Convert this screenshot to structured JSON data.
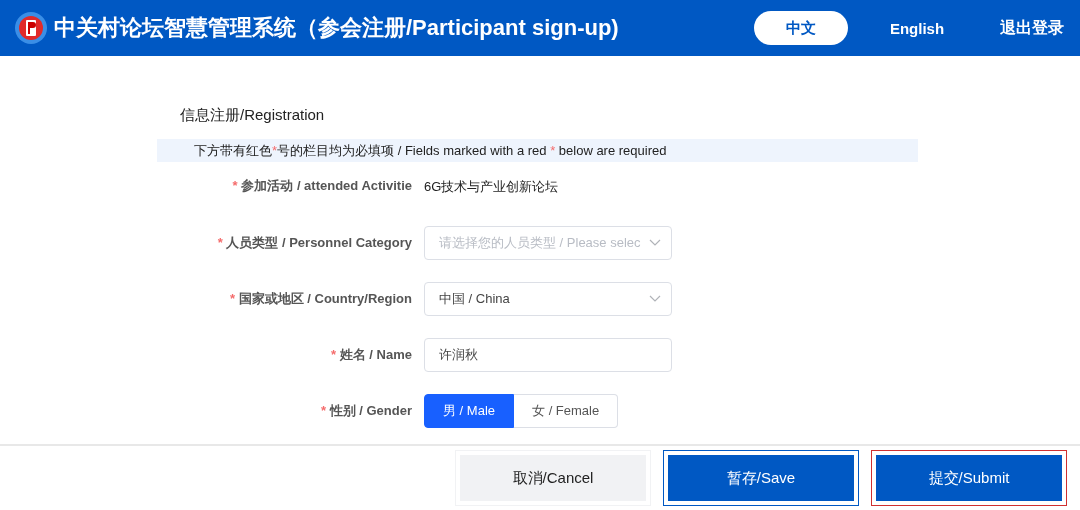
{
  "header": {
    "title": "中关村论坛智慧管理系统（参会注册/Participant sign-up)",
    "languages": [
      {
        "label": "中文",
        "selected": true
      },
      {
        "label": "English",
        "selected": false
      }
    ],
    "logout": "退出登录"
  },
  "section_title": "信息注册/Registration",
  "notice": [
    {
      "kind": "text",
      "text": "下方带有红色"
    },
    {
      "kind": "mark",
      "text": "*"
    },
    {
      "kind": "text",
      "text": "号的栏目均为必填项 / Fields marked with a red "
    },
    {
      "kind": "mark",
      "text": "*"
    },
    {
      "kind": "text",
      "text": " below are required"
    }
  ],
  "fields": [
    {
      "kind": "text",
      "required_mark": "*",
      "label": "参加活动 / attended Activitie",
      "value": "6G技术与产业创新论坛"
    },
    {
      "kind": "select",
      "required_mark": "*",
      "label": "人员类型 / Personnel Category",
      "placeholder": "请选择您的人员类型 / Please selec"
    },
    {
      "kind": "select",
      "required_mark": "*",
      "label": "国家或地区 / Country/Region",
      "value": "中国 / China"
    },
    {
      "kind": "input",
      "required_mark": "*",
      "label": "姓名 / Name",
      "value": "许润秋"
    },
    {
      "kind": "segmented",
      "required_mark": "*",
      "label": "性别 / Gender",
      "options": [
        {
          "label": "男 / Male",
          "selected": true
        },
        {
          "label": "女 / Female",
          "selected": false
        }
      ]
    }
  ],
  "buttons": [
    {
      "label": "取消/Cancel",
      "kind": "secondary",
      "focused": false
    },
    {
      "label": "暂存/Save",
      "kind": "primary",
      "focused": false
    },
    {
      "label": "提交/Submit",
      "kind": "primary",
      "focused": true
    }
  ]
}
